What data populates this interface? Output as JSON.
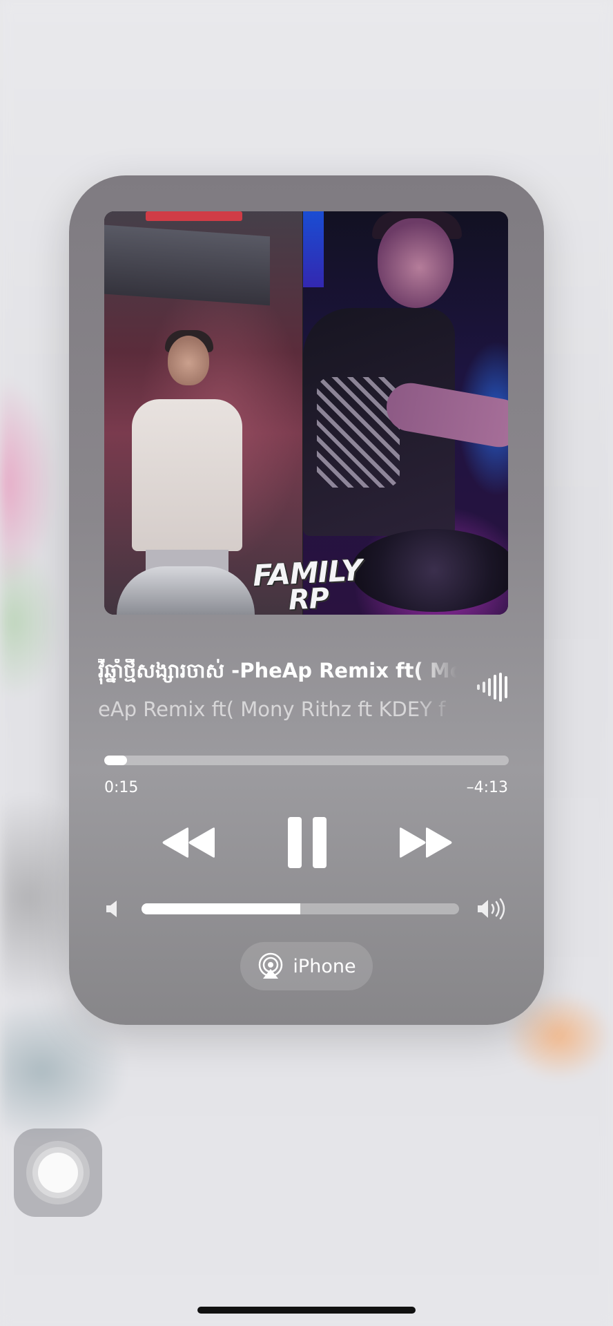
{
  "now_playing": {
    "title": "វ៉ីឆ្នាំថ្មីសង្សារចាស់ -PheAp Remix ft( Mony Rithz ft KDEY f",
    "subtitle": "eAp Remix ft( Mony Rithz ft KDEY f",
    "artwork": {
      "logo_line1": "FAMILY",
      "logo_line2": "RP"
    },
    "elapsed": "0:15",
    "remaining": "–4:13",
    "progress_fraction": 0.057,
    "volume_fraction": 0.5,
    "output_device": "iPhone",
    "controls": {
      "rewind_icon": "rewind-icon",
      "pause_icon": "pause-icon",
      "forward_icon": "fast-forward-icon",
      "airplay_icon": "airplay-icon",
      "volume_low_icon": "volume-low-icon",
      "volume_high_icon": "volume-high-icon",
      "waveform_icon": "waveform-icon"
    }
  },
  "colors": {
    "card": "#8a878c",
    "accent": "#ffffff",
    "background": "#e7e7ea"
  }
}
